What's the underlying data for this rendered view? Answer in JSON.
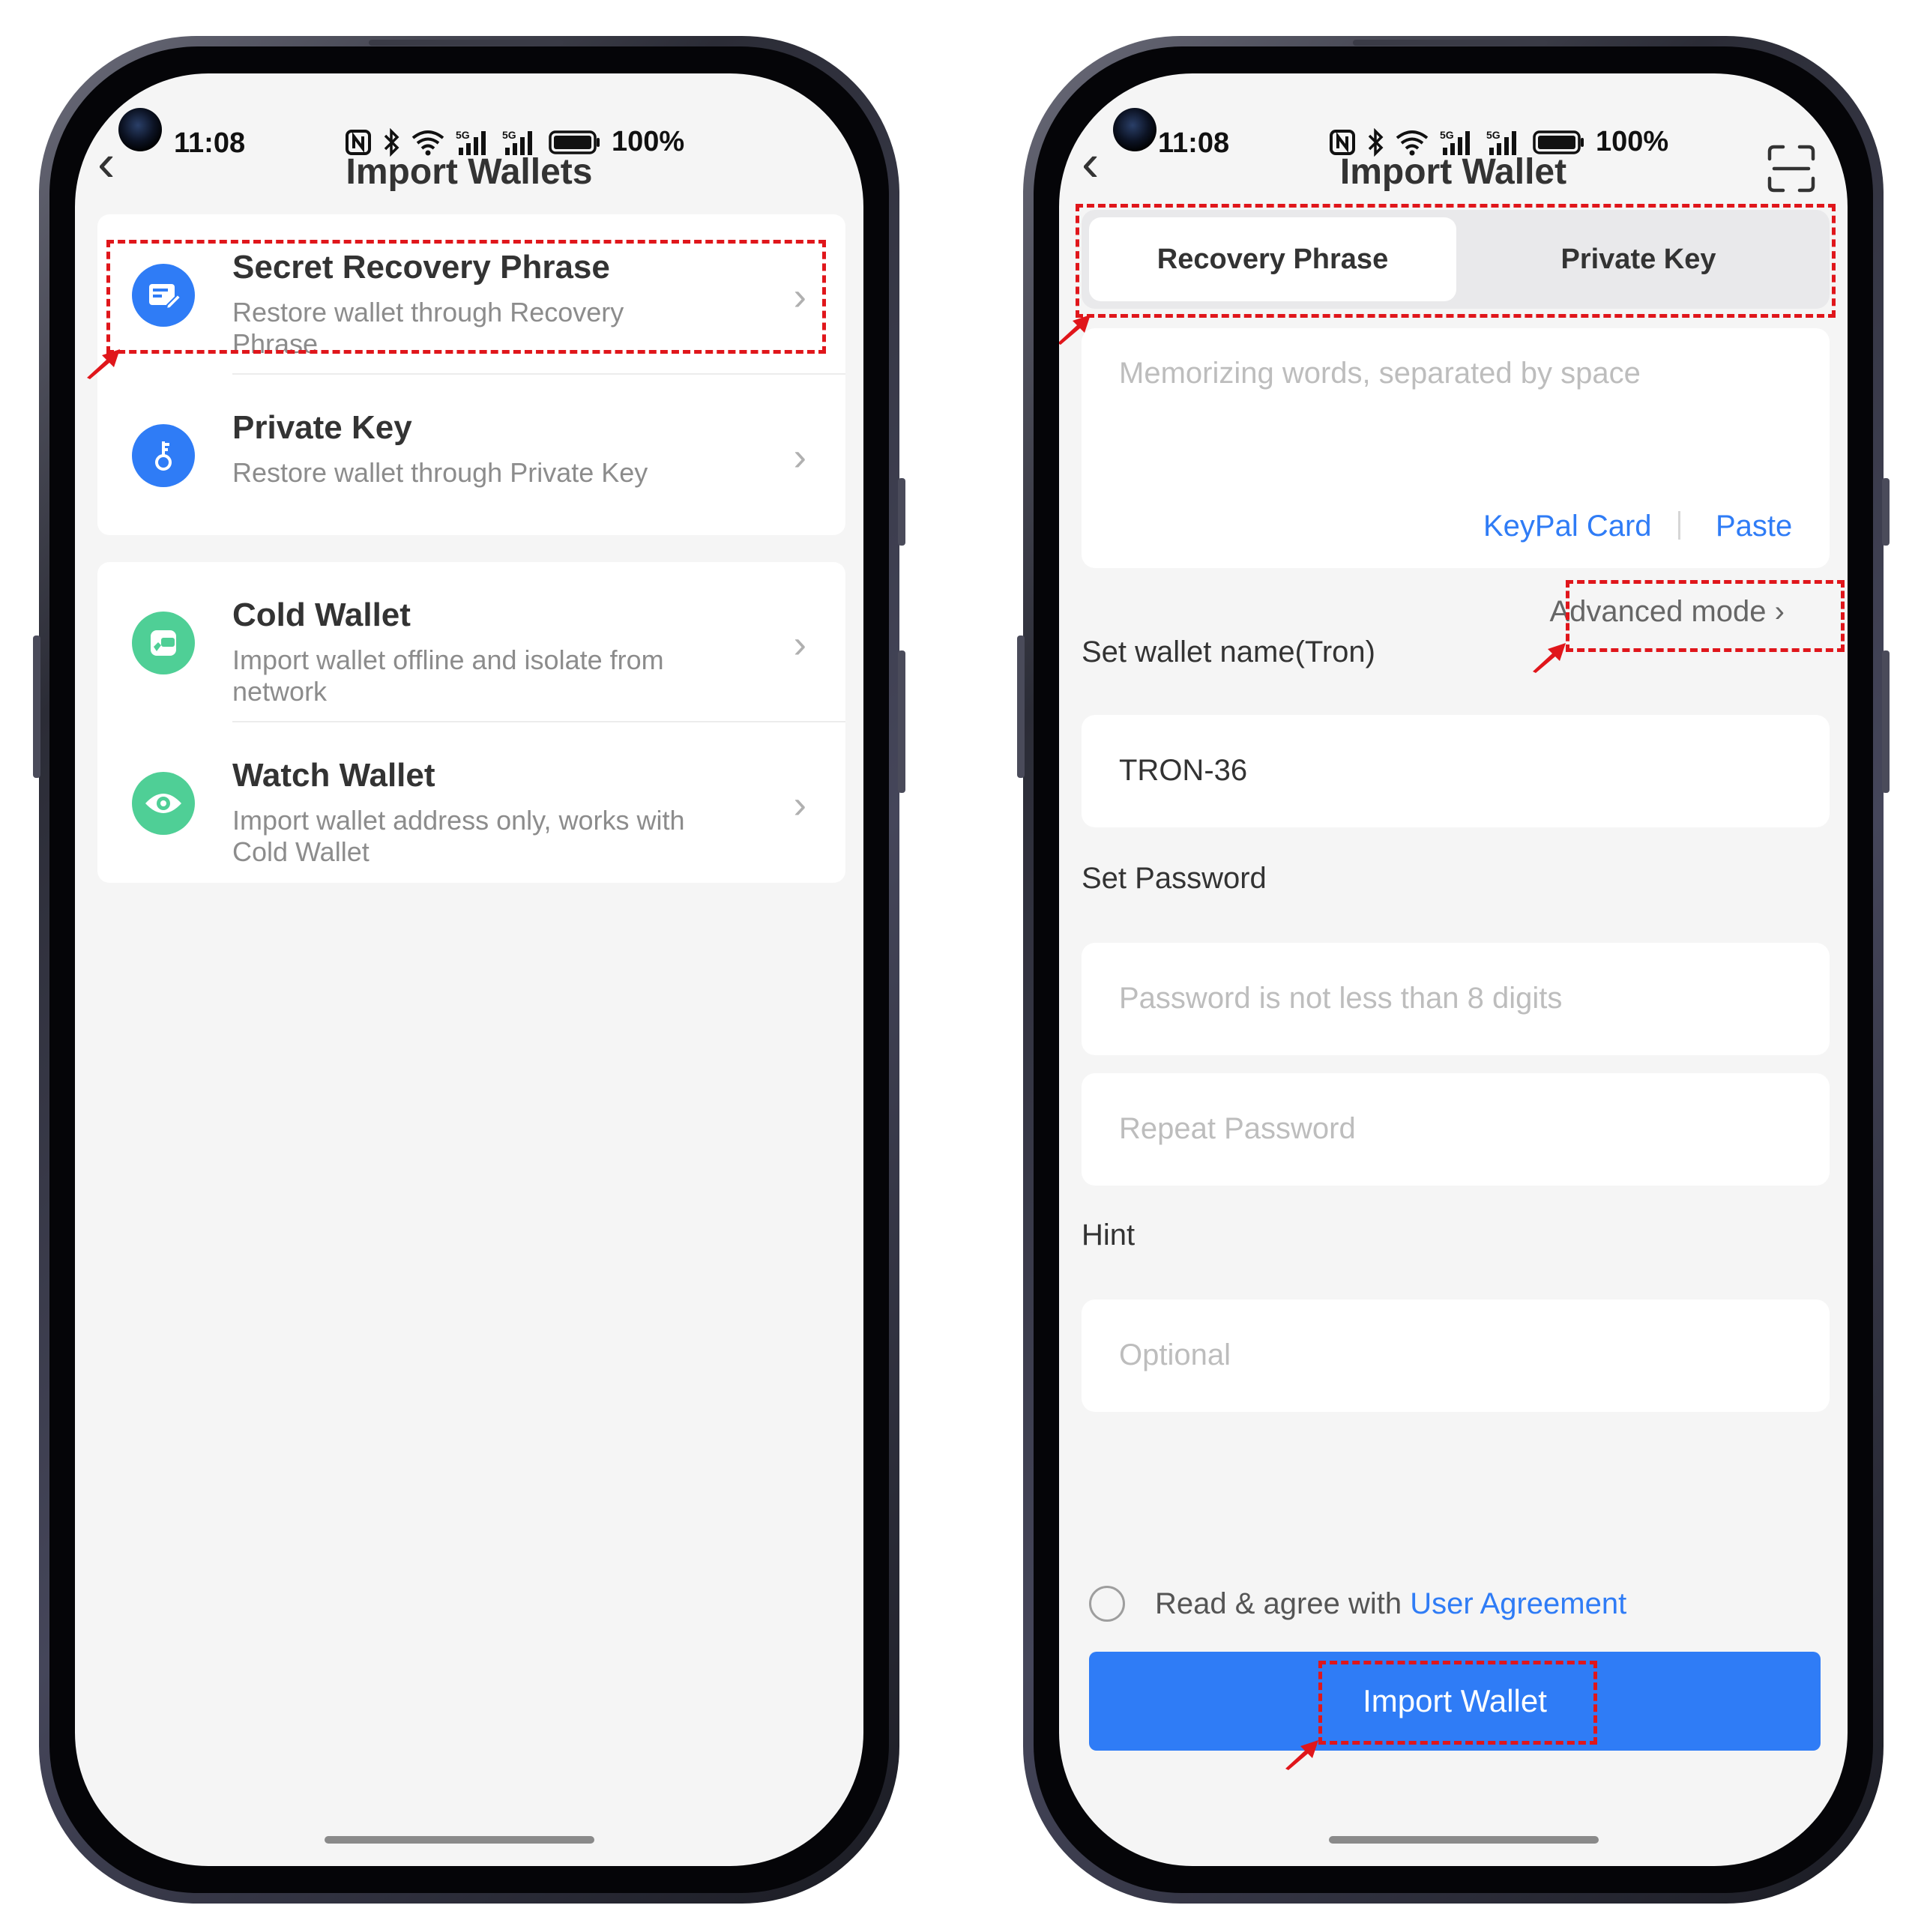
{
  "left_screen": {
    "status": {
      "time": "11:08",
      "battery": "100%"
    },
    "title": "Import Wallets",
    "items": [
      {
        "title": "Secret Recovery Phrase",
        "subtitle": "Restore wallet through Recovery Phrase",
        "icon": "recovery-phrase-icon"
      },
      {
        "title": "Private Key",
        "subtitle": "Restore wallet through Private Key",
        "icon": "key-icon"
      },
      {
        "title": "Cold Wallet",
        "subtitle": "Import wallet offline and isolate from network",
        "icon": "cold-wallet-icon"
      },
      {
        "title": "Watch Wallet",
        "subtitle": "Import wallet address only, works with Cold Wallet",
        "icon": "eye-icon"
      }
    ]
  },
  "right_screen": {
    "status": {
      "time": "11:08",
      "battery": "100%"
    },
    "title": "Import Wallet",
    "tabs": [
      "Recovery Phrase",
      "Private Key"
    ],
    "phrase_placeholder": "Memorizing words, separated by space",
    "keypal_label": "KeyPal Card",
    "paste_label": "Paste",
    "advanced_mode": "Advanced mode",
    "wallet_name_label": "Set wallet name(Tron)",
    "wallet_name_value": "TRON-36",
    "password_label": "Set Password",
    "password_placeholder": "Password is not less than 8 digits",
    "repeat_placeholder": "Repeat Password",
    "hint_label": "Hint",
    "hint_placeholder": "Optional",
    "agree_text": "Read & agree with ",
    "agree_link": "User Agreement",
    "import_button": "Import Wallet"
  },
  "colors": {
    "accent_blue": "#2f7cf6",
    "green": "#4fcf96",
    "annotation_red": "#e0161b"
  }
}
